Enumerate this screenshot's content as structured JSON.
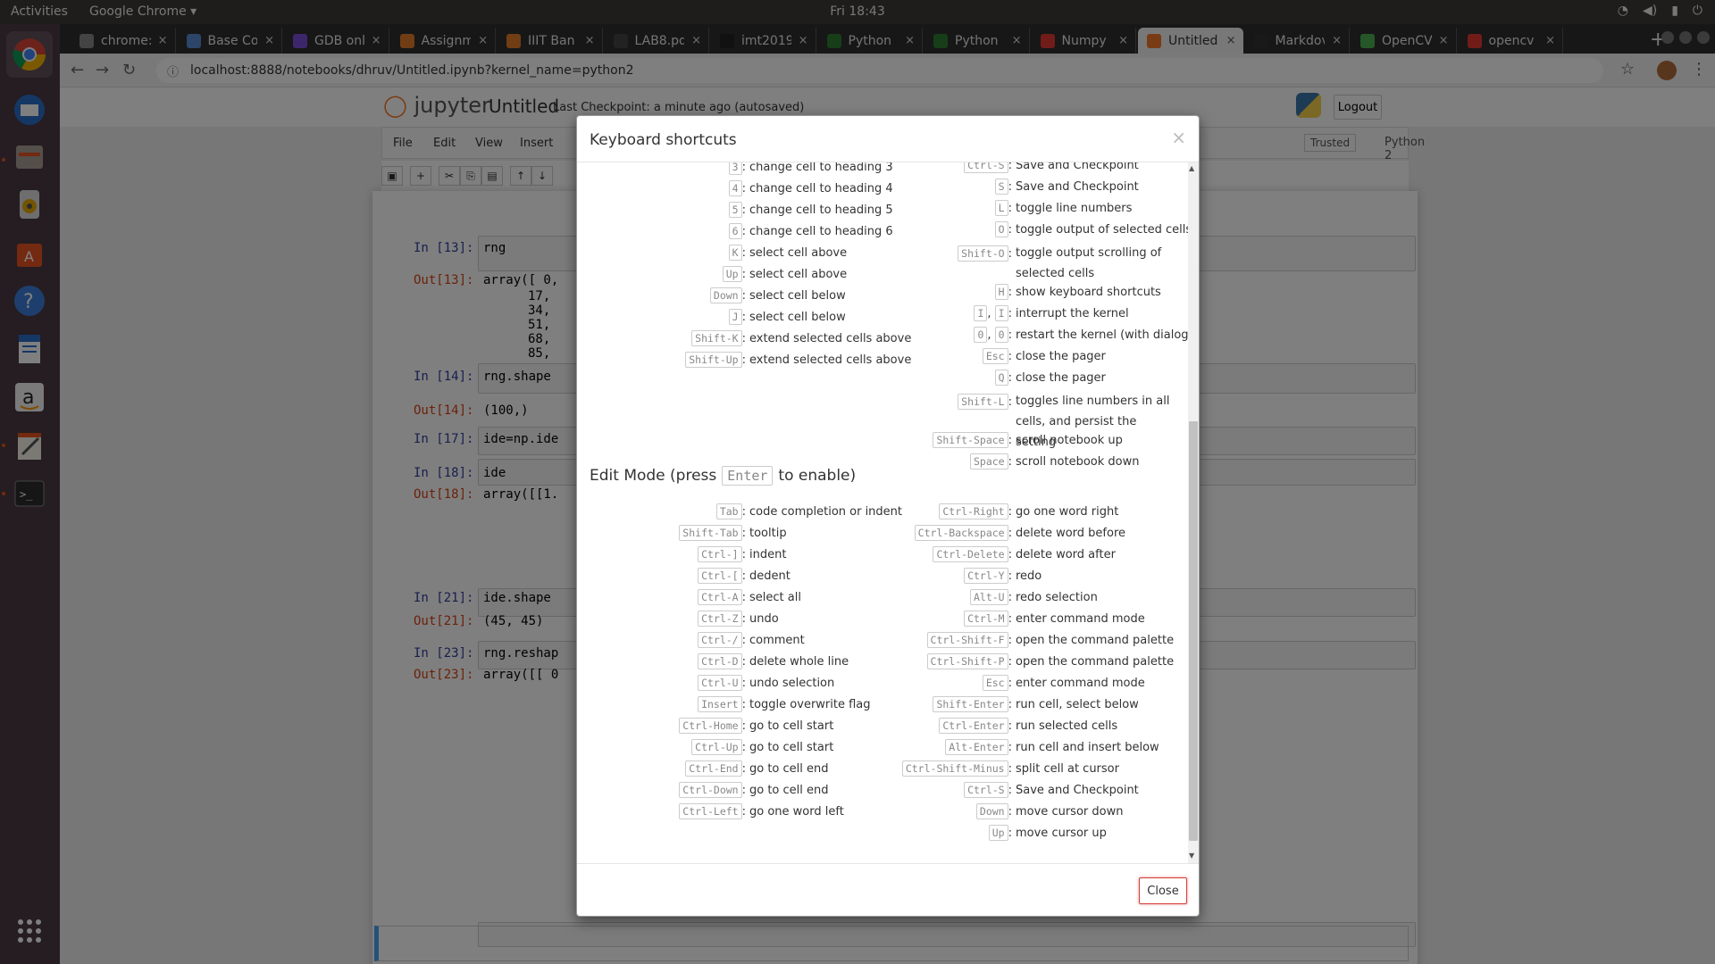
{
  "topbar": {
    "activities": "Activities",
    "app": "Google Chrome ▾",
    "clock": "Fri 18:43"
  },
  "tabs": [
    {
      "title": "chrome:",
      "color": "#888888"
    },
    {
      "title": "Base Co",
      "color": "#5b8bd0"
    },
    {
      "title": "GDB onl",
      "color": "#7b4fd8"
    },
    {
      "title": "Assignm",
      "color": "#e07a2a"
    },
    {
      "title": "IIIT Ban",
      "color": "#e07a2a"
    },
    {
      "title": "LAB8.pd",
      "color": "#444444"
    },
    {
      "title": "imt2019",
      "color": "#222222"
    },
    {
      "title": "Python",
      "color": "#2e7d32"
    },
    {
      "title": "Python",
      "color": "#2e7d32"
    },
    {
      "title": "Numpy",
      "color": "#e53935"
    },
    {
      "title": "Untitled",
      "color": "#f37726"
    },
    {
      "title": "Markdov",
      "color": "#333333"
    },
    {
      "title": "OpenCV",
      "color": "#4caf50"
    },
    {
      "title": "opencv",
      "color": "#e53935"
    }
  ],
  "address": {
    "url": "localhost:8888/notebooks/dhruv/Untitled.ipynb?kernel_name=python2"
  },
  "jupyter": {
    "logo": "jupyter",
    "notebook_name": "Untitled",
    "checkpoint": "Last Checkpoint: a minute ago  (autosaved)",
    "logout": "Logout",
    "menu": [
      "File",
      "Edit",
      "View",
      "Insert"
    ],
    "trusted": "Trusted",
    "kernel": "Python 2",
    "cells": [
      {
        "prompt": "In [13]:",
        "code": "rng"
      },
      {
        "prompt": "Out[13]:",
        "code": "array([ 0,"
      },
      {
        "prompt": "",
        "code": "17,"
      },
      {
        "prompt": "",
        "code": "34,"
      },
      {
        "prompt": "",
        "code": "51,"
      },
      {
        "prompt": "",
        "code": "68,"
      },
      {
        "prompt": "",
        "code": "85,"
      },
      {
        "prompt": "In [14]:",
        "code": "rng.shape"
      },
      {
        "prompt": "Out[14]:",
        "code": "(100,)"
      },
      {
        "prompt": "In [17]:",
        "code": "ide=np.ide"
      },
      {
        "prompt": "In [18]:",
        "code": "ide"
      },
      {
        "prompt": "Out[18]:",
        "code": "array([[1."
      },
      {
        "prompt": "In [21]:",
        "code": "ide.shape"
      },
      {
        "prompt": "Out[21]:",
        "code": "(45, 45)"
      },
      {
        "prompt": "In [23]:",
        "code": "rng.reshap"
      },
      {
        "prompt": "Out[23]:",
        "code": "array([[ 0"
      }
    ]
  },
  "modal": {
    "title": "Keyboard shortcuts",
    "close_x": "×",
    "close_button": "Close",
    "edit_mode_prefix": "Edit Mode (press",
    "edit_mode_key": "Enter",
    "edit_mode_suffix": "to enable)",
    "command_left": [
      {
        "keys": [
          "3"
        ],
        "desc": "change cell to heading 3"
      },
      {
        "keys": [
          "4"
        ],
        "desc": "change cell to heading 4"
      },
      {
        "keys": [
          "5"
        ],
        "desc": "change cell to heading 5"
      },
      {
        "keys": [
          "6"
        ],
        "desc": "change cell to heading 6"
      },
      {
        "keys": [
          "K"
        ],
        "desc": "select cell above"
      },
      {
        "keys": [
          "Up"
        ],
        "desc": "select cell above"
      },
      {
        "keys": [
          "Down"
        ],
        "desc": "select cell below"
      },
      {
        "keys": [
          "J"
        ],
        "desc": "select cell below"
      },
      {
        "keys": [
          "Shift-K"
        ],
        "desc": "extend selected cells above"
      },
      {
        "keys": [
          "Shift-Up"
        ],
        "desc": "extend selected cells above"
      }
    ],
    "command_right": [
      {
        "keys": [
          "Ctrl-S"
        ],
        "desc": "Save and Checkpoint"
      },
      {
        "keys": [
          "S"
        ],
        "desc": "Save and Checkpoint"
      },
      {
        "keys": [
          "L"
        ],
        "desc": "toggle line numbers"
      },
      {
        "keys": [
          "O"
        ],
        "desc": "toggle output of selected cells"
      },
      {
        "keys": [
          "Shift-O"
        ],
        "desc": "toggle output scrolling of selected cells"
      },
      {
        "keys": [
          "H"
        ],
        "desc": "show keyboard shortcuts"
      },
      {
        "keys": [
          "I",
          "I"
        ],
        "desc": "interrupt the kernel"
      },
      {
        "keys": [
          "0",
          "0"
        ],
        "desc": "restart the kernel (with dialog)"
      },
      {
        "keys": [
          "Esc"
        ],
        "desc": "close the pager"
      },
      {
        "keys": [
          "Q"
        ],
        "desc": "close the pager"
      },
      {
        "keys": [
          "Shift-L"
        ],
        "desc": "toggles line numbers in all cells, and persist the setting"
      },
      {
        "keys": [
          "Shift-Space"
        ],
        "desc": "scroll notebook up"
      },
      {
        "keys": [
          "Space"
        ],
        "desc": "scroll notebook down"
      }
    ],
    "edit_left": [
      {
        "keys": [
          "Tab"
        ],
        "desc": "code completion or indent"
      },
      {
        "keys": [
          "Shift-Tab"
        ],
        "desc": "tooltip"
      },
      {
        "keys": [
          "Ctrl-]"
        ],
        "desc": "indent"
      },
      {
        "keys": [
          "Ctrl-["
        ],
        "desc": "dedent"
      },
      {
        "keys": [
          "Ctrl-A"
        ],
        "desc": "select all"
      },
      {
        "keys": [
          "Ctrl-Z"
        ],
        "desc": "undo"
      },
      {
        "keys": [
          "Ctrl-/"
        ],
        "desc": "comment"
      },
      {
        "keys": [
          "Ctrl-D"
        ],
        "desc": "delete whole line"
      },
      {
        "keys": [
          "Ctrl-U"
        ],
        "desc": "undo selection"
      },
      {
        "keys": [
          "Insert"
        ],
        "desc": "toggle overwrite flag"
      },
      {
        "keys": [
          "Ctrl-Home"
        ],
        "desc": "go to cell start"
      },
      {
        "keys": [
          "Ctrl-Up"
        ],
        "desc": "go to cell start"
      },
      {
        "keys": [
          "Ctrl-End"
        ],
        "desc": "go to cell end"
      },
      {
        "keys": [
          "Ctrl-Down"
        ],
        "desc": "go to cell end"
      },
      {
        "keys": [
          "Ctrl-Left"
        ],
        "desc": "go one word left"
      }
    ],
    "edit_right": [
      {
        "keys": [
          "Ctrl-Right"
        ],
        "desc": "go one word right"
      },
      {
        "keys": [
          "Ctrl-Backspace"
        ],
        "desc": "delete word before"
      },
      {
        "keys": [
          "Ctrl-Delete"
        ],
        "desc": "delete word after"
      },
      {
        "keys": [
          "Ctrl-Y"
        ],
        "desc": "redo"
      },
      {
        "keys": [
          "Alt-U"
        ],
        "desc": "redo selection"
      },
      {
        "keys": [
          "Ctrl-M"
        ],
        "desc": "enter command mode"
      },
      {
        "keys": [
          "Ctrl-Shift-F"
        ],
        "desc": "open the command palette"
      },
      {
        "keys": [
          "Ctrl-Shift-P"
        ],
        "desc": "open the command palette"
      },
      {
        "keys": [
          "Esc"
        ],
        "desc": "enter command mode"
      },
      {
        "keys": [
          "Shift-Enter"
        ],
        "desc": "run cell, select below"
      },
      {
        "keys": [
          "Ctrl-Enter"
        ],
        "desc": "run selected cells"
      },
      {
        "keys": [
          "Alt-Enter"
        ],
        "desc": "run cell and insert below"
      },
      {
        "keys": [
          "Ctrl-Shift-Minus"
        ],
        "desc": "split cell at cursor"
      },
      {
        "keys": [
          "Ctrl-S"
        ],
        "desc": "Save and Checkpoint"
      },
      {
        "keys": [
          "Down"
        ],
        "desc": "move cursor down"
      },
      {
        "keys": [
          "Up"
        ],
        "desc": "move cursor up"
      }
    ]
  },
  "colors": {
    "dock": "#4b3a45",
    "topbar": "#3c3b37",
    "close_border": "#d43f3a"
  }
}
